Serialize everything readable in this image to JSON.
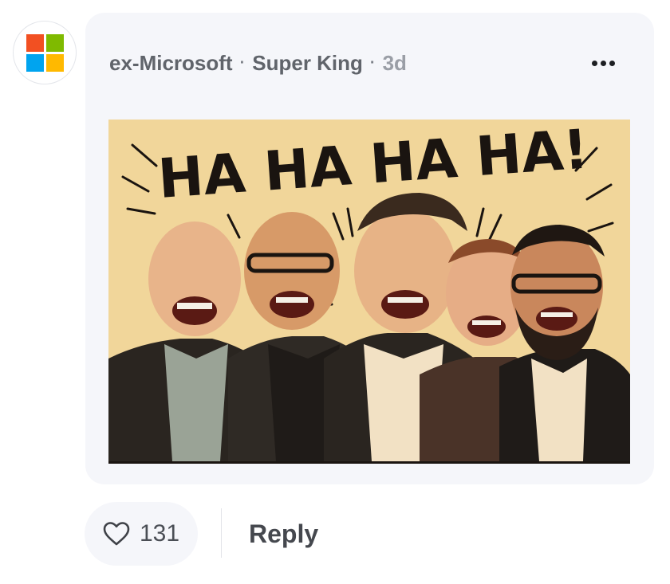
{
  "post": {
    "author": "ex-Microsoft",
    "flair": "Super King",
    "age": "3d",
    "avatar_icon": "microsoft-logo-icon",
    "image_text": "HA HA HA HA!"
  },
  "actions": {
    "like_count": "131",
    "reply_label": "Reply"
  },
  "colors": {
    "ms_red": "#f25022",
    "ms_green": "#7fba00",
    "ms_blue": "#00a4ef",
    "ms_yellow": "#ffb900",
    "card_bg": "#f5f6fa"
  }
}
